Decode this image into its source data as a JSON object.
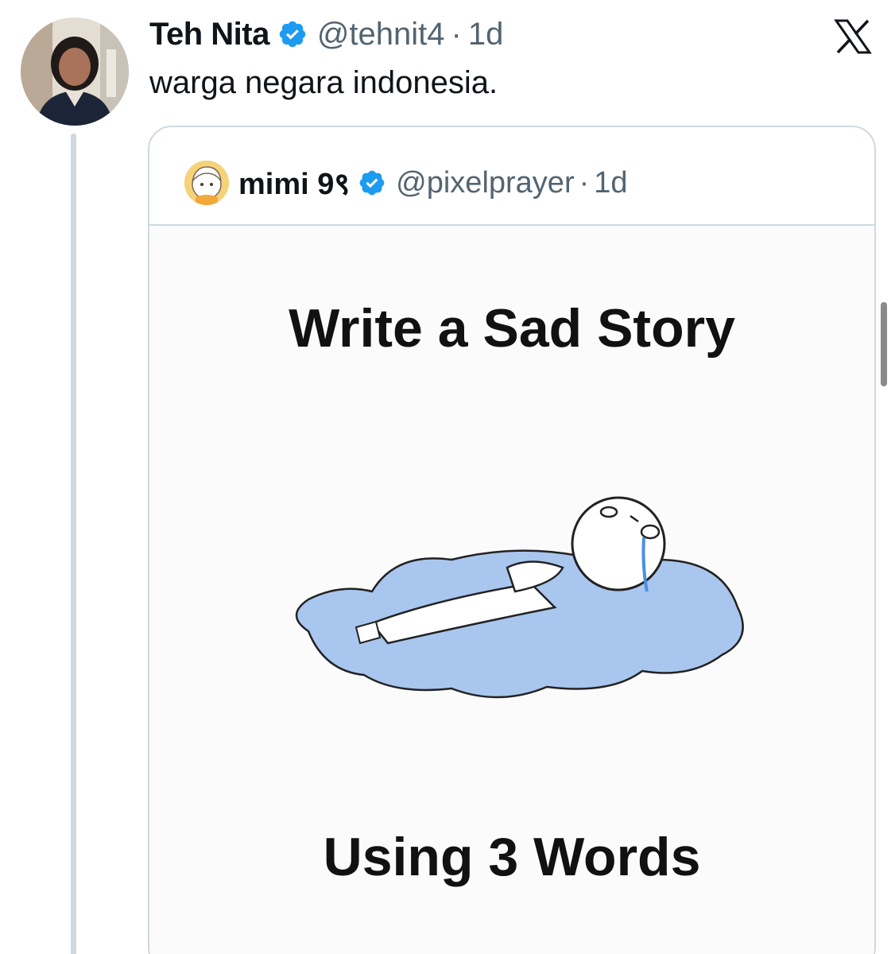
{
  "tweet": {
    "author_name": "Teh Nita",
    "handle": "@tehnit4",
    "separator": "·",
    "time": "1d",
    "text": "warga negara indonesia.",
    "verified_icon": "verified-badge-icon",
    "platform_icon": "x-logo-icon"
  },
  "quote": {
    "author_name": "mimi 9९",
    "handle": "@pixelprayer",
    "separator": "·",
    "time": "1d",
    "verified_icon": "verified-badge-icon",
    "meme": {
      "title": "Write a Sad Story",
      "caption": "Using 3 Words"
    }
  },
  "colors": {
    "verified_blue": "#1d9bf0",
    "secondary_text": "#536471",
    "border": "#cfd9de",
    "puddle_blue": "#a9c6ef"
  }
}
